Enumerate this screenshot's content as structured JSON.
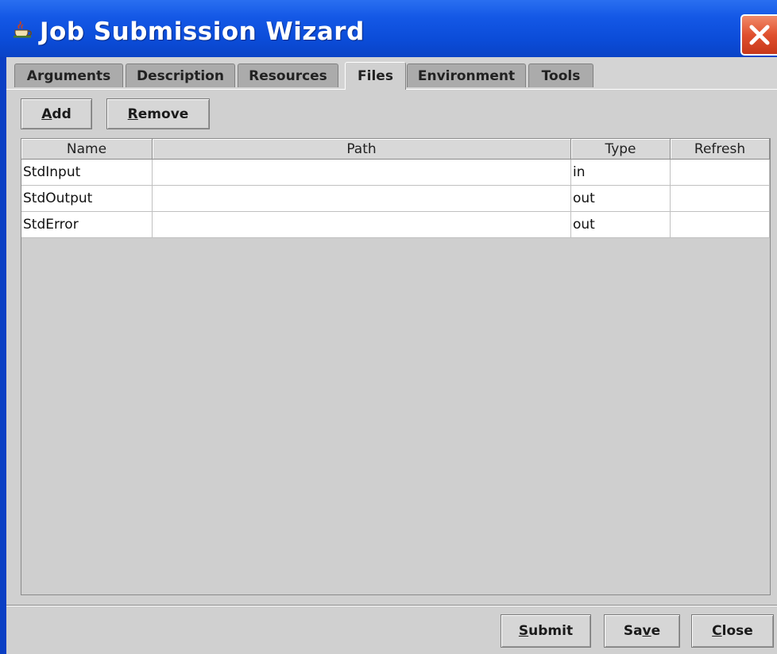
{
  "window": {
    "title": "Job Submission Wizard",
    "title_icon": "java-cup-icon",
    "close_icon": "close-icon"
  },
  "tabs": [
    {
      "label": "Arguments",
      "active": false
    },
    {
      "label": "Description",
      "active": false
    },
    {
      "label": "Resources",
      "active": false
    },
    {
      "label": "Files",
      "active": true
    },
    {
      "label": "Environment",
      "active": false
    },
    {
      "label": "Tools",
      "active": false
    }
  ],
  "toolbar": {
    "add": {
      "mnemonic": "A",
      "rest": "dd"
    },
    "remove": {
      "mnemonic": "R",
      "rest": "emove"
    }
  },
  "table": {
    "columns": [
      "Name",
      "Path",
      "Type",
      "Refresh"
    ],
    "rows": [
      {
        "name": "StdInput",
        "path": "",
        "type": "in",
        "refresh": ""
      },
      {
        "name": "StdOutput",
        "path": "",
        "type": "out",
        "refresh": ""
      },
      {
        "name": "StdError",
        "path": "",
        "type": "out",
        "refresh": ""
      }
    ]
  },
  "footer": {
    "submit": {
      "pre": "",
      "mnemonic": "S",
      "post": "ubmit"
    },
    "save": {
      "pre": "Sa",
      "mnemonic": "v",
      "post": "e"
    },
    "close": {
      "pre": "",
      "mnemonic": "C",
      "post": "lose"
    }
  },
  "colors": {
    "titlebar": "#0b4cd8",
    "client_bg": "#d0d0d0",
    "close_button": "#e0502e"
  }
}
